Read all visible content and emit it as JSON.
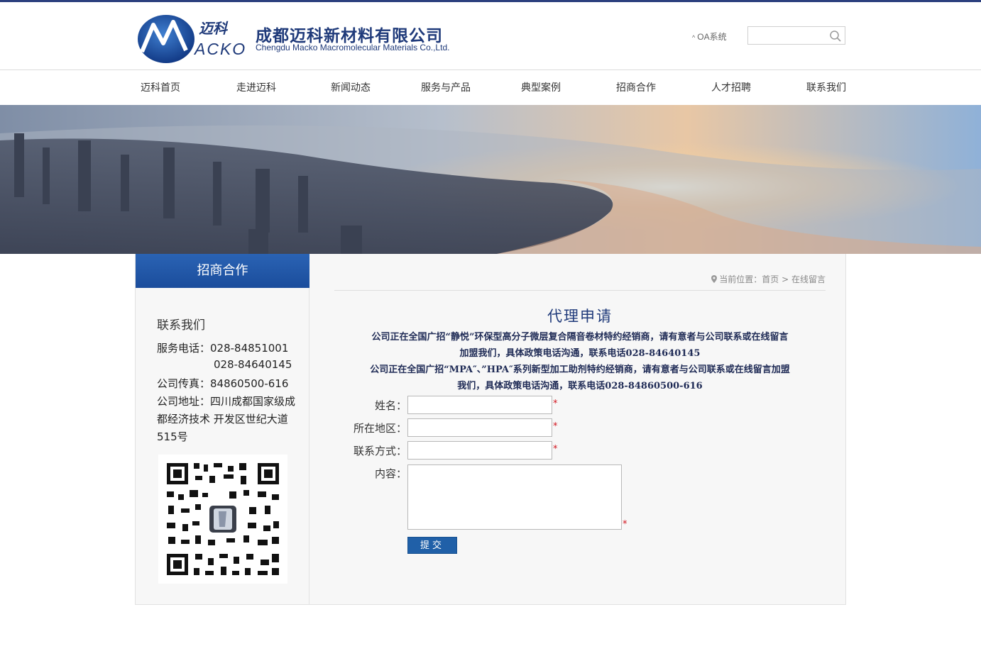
{
  "brand": {
    "logo_text": "迈科",
    "logo_word": "ACKO",
    "company_cn": "成都迈科新材料有限公司",
    "company_en": "Chengdu Macko Macromolecular Materials Co.,Ltd.",
    "primary_color": "#1f3a7a",
    "accent_color": "#2060a8"
  },
  "header": {
    "oa_label": "OA系统",
    "search_placeholder": ""
  },
  "nav": [
    {
      "label": "迈科首页"
    },
    {
      "label": "走进迈科"
    },
    {
      "label": "新闻动态"
    },
    {
      "label": "服务与产品"
    },
    {
      "label": "典型案例"
    },
    {
      "label": "招商合作"
    },
    {
      "label": "人才招聘"
    },
    {
      "label": "联系我们"
    }
  ],
  "sidebar": {
    "title": "招商合作",
    "contact_title": "联系我们",
    "lines": [
      "服务电话：028-84851001",
      "028-84640145",
      "公司传真：84860500-616",
      "公司地址：四川成都国家级成",
      "都经济技术 开发区世纪大道",
      "515号"
    ]
  },
  "breadcrumb": {
    "prefix": "当前位置：",
    "home": "首页",
    "separator": ">",
    "current": "在线留言"
  },
  "form": {
    "title": "代理申请",
    "notice": [
      "公司正在全国广招“静悦”环保型高分子微层复合隔音卷材特约经销商，请有意者与公司联系或在线留言",
      "加盟我们，具体政策电话沟通，联系电话028-84640145",
      "公司正在全国广招“MPA″、”HPA″系列新型加工助剂特约经销商，请有意者与公司联系或在线留言加盟",
      "我们，具体政策电话沟通，联系电话028-84860500-616"
    ],
    "fields": {
      "name_label": "姓名：",
      "region_label": "所在地区：",
      "contact_label": "联系方式：",
      "content_label": "内容："
    },
    "required_mark": "*",
    "submit_label": "提交"
  }
}
